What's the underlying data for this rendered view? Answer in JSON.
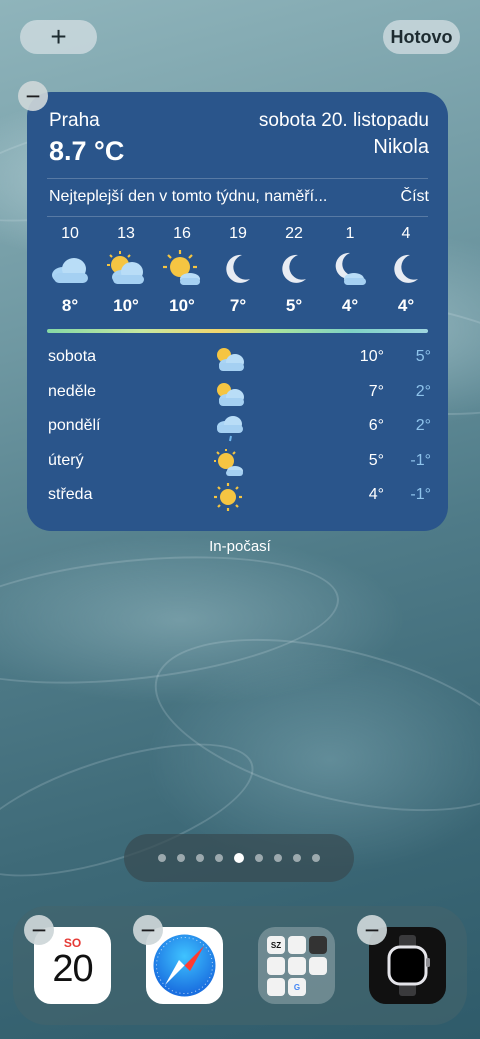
{
  "top_bar": {
    "add_label": "+",
    "done_label": "Hotovo"
  },
  "widget": {
    "city": "Praha",
    "temperature": "8.7 °C",
    "date": "sobota 20. listopadu",
    "nameday": "Nikola",
    "news": "Nejteplejší den v tomto týdnu, naměří...",
    "read_label": "Číst",
    "hourly": [
      {
        "hour": "10",
        "icon": "cloud-icon",
        "temp": "8°"
      },
      {
        "hour": "13",
        "icon": "partly-cloudy-icon",
        "temp": "10°"
      },
      {
        "hour": "16",
        "icon": "sun-behind-cloud-icon",
        "temp": "10°"
      },
      {
        "hour": "19",
        "icon": "moon-icon",
        "temp": "7°"
      },
      {
        "hour": "22",
        "icon": "moon-icon",
        "temp": "5°"
      },
      {
        "hour": "1",
        "icon": "moon-cloud-icon",
        "temp": "4°"
      },
      {
        "hour": "4",
        "icon": "moon-icon",
        "temp": "4°"
      }
    ],
    "daily": [
      {
        "day": "sobota",
        "icon": "partly-cloudy-icon",
        "high": "10°",
        "low": "5°"
      },
      {
        "day": "neděle",
        "icon": "partly-cloudy-icon",
        "high": "7°",
        "low": "2°"
      },
      {
        "day": "pondělí",
        "icon": "rain-cloud-icon",
        "high": "6°",
        "low": "2°"
      },
      {
        "day": "úterý",
        "icon": "sun-cloud-icon",
        "high": "5°",
        "low": "-1°"
      },
      {
        "day": "středa",
        "icon": "sun-icon",
        "high": "4°",
        "low": "-1°"
      }
    ]
  },
  "widget_label": "In-počasí",
  "pager": {
    "pages": 9,
    "active_index": 4
  },
  "dock": {
    "calendar_weekday": "SO",
    "calendar_day": "20",
    "folder_cells": [
      "SZ",
      "",
      "",
      "",
      "",
      "",
      "",
      "G"
    ]
  },
  "colors": {
    "widget_bg": "#2a558b",
    "low_temp": "#8fc4ec",
    "calendar_red": "#e53935"
  }
}
